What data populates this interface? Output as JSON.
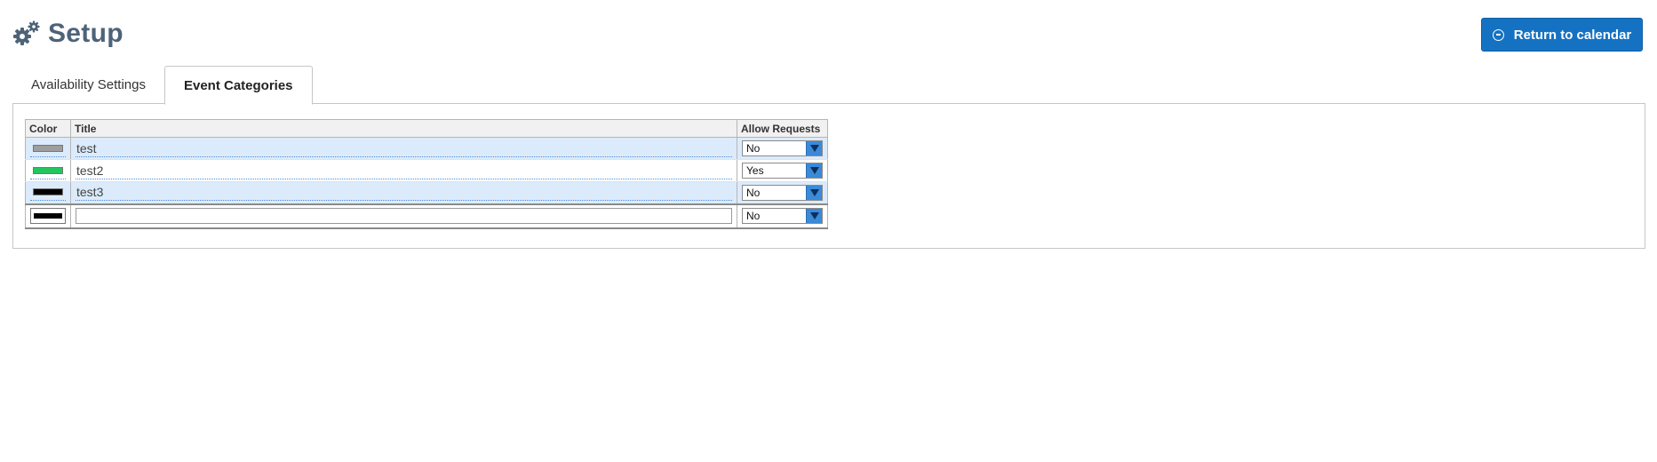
{
  "header": {
    "title": "Setup",
    "icon": "gears-icon",
    "return_button": {
      "label": "Return to calendar",
      "icon": "circle-arrow-left-icon"
    }
  },
  "tabs": [
    {
      "label": "Availability Settings",
      "active": false
    },
    {
      "label": "Event Categories",
      "active": true
    }
  ],
  "table": {
    "columns": [
      "Color",
      "Title",
      "Allow Requests"
    ],
    "rows": [
      {
        "color": "#9e9e9e",
        "title": "test",
        "allow_requests": "No"
      },
      {
        "color": "#22c55e",
        "title": "test2",
        "allow_requests": "Yes"
      },
      {
        "color": "#000000",
        "title": "test3",
        "allow_requests": "No"
      }
    ],
    "new_row": {
      "color": "#000000",
      "title_value": "",
      "allow_requests": "No"
    }
  },
  "colors": {
    "accent": "#1572c2",
    "title": "#4d6378",
    "row_highlight": "#dcebfb",
    "select_arrow": "#3b8ad8"
  }
}
